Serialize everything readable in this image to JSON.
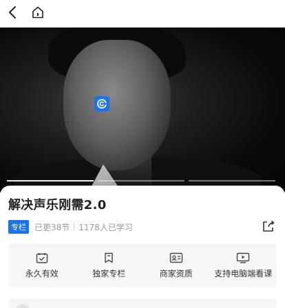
{
  "nav": {
    "back_icon": "chevron-left-icon",
    "home_icon": "home-icon"
  },
  "hero": {
    "badge_icon": "brand-logo-icon",
    "progress": {
      "segments": 3,
      "active_index": 0
    }
  },
  "course": {
    "title": "解决声乐刚需2.0",
    "tag": "专栏",
    "updated": "已更38节",
    "learners": "1178人已学习",
    "share_icon": "share-icon"
  },
  "features": [
    {
      "icon": "calendar-check-icon",
      "label": "永久有效"
    },
    {
      "icon": "bookmark-icon",
      "label": "独家专栏"
    },
    {
      "icon": "id-card-icon",
      "label": "商家资质"
    },
    {
      "icon": "tv-play-icon",
      "label": "支持电脑端看课"
    }
  ],
  "colors": {
    "accent": "#1a73e8",
    "text_primary": "#222222",
    "text_secondary": "#999999",
    "panel_bg": "#f5f6f8"
  }
}
